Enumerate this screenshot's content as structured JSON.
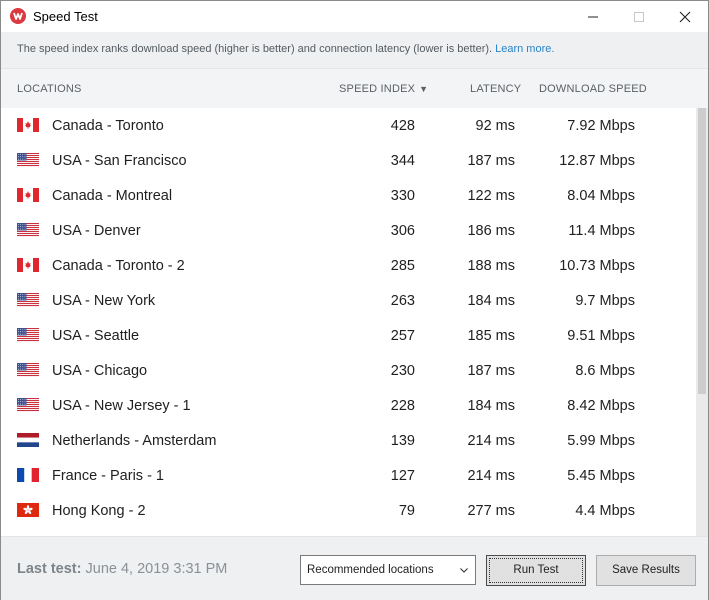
{
  "window": {
    "title": "Speed Test",
    "controls": [
      "minimize-icon",
      "maximize-icon",
      "close-icon"
    ]
  },
  "info": {
    "text": "The speed index ranks download speed (higher is better) and connection latency (lower is better).",
    "link": "Learn more."
  },
  "table": {
    "headers": {
      "location": "LOCATIONS",
      "speed_index": "SPEED INDEX",
      "sort_indicator": "▼",
      "latency": "LATENCY",
      "download": "DOWNLOAD SPEED"
    },
    "rows": [
      {
        "flag": "ca",
        "name": "Canada - Toronto",
        "speed_index": "428",
        "latency": "92 ms",
        "download": "7.92 Mbps"
      },
      {
        "flag": "us",
        "name": "USA - San Francisco",
        "speed_index": "344",
        "latency": "187 ms",
        "download": "12.87 Mbps"
      },
      {
        "flag": "ca",
        "name": "Canada - Montreal",
        "speed_index": "330",
        "latency": "122 ms",
        "download": "8.04 Mbps"
      },
      {
        "flag": "us",
        "name": "USA - Denver",
        "speed_index": "306",
        "latency": "186 ms",
        "download": "11.4 Mbps"
      },
      {
        "flag": "ca",
        "name": "Canada - Toronto - 2",
        "speed_index": "285",
        "latency": "188 ms",
        "download": "10.73 Mbps"
      },
      {
        "flag": "us",
        "name": "USA - New York",
        "speed_index": "263",
        "latency": "184 ms",
        "download": "9.7 Mbps"
      },
      {
        "flag": "us",
        "name": "USA - Seattle",
        "speed_index": "257",
        "latency": "185 ms",
        "download": "9.51 Mbps"
      },
      {
        "flag": "us",
        "name": "USA - Chicago",
        "speed_index": "230",
        "latency": "187 ms",
        "download": "8.6 Mbps"
      },
      {
        "flag": "us",
        "name": "USA - New Jersey - 1",
        "speed_index": "228",
        "latency": "184 ms",
        "download": "8.42 Mbps"
      },
      {
        "flag": "nl",
        "name": "Netherlands - Amsterdam",
        "speed_index": "139",
        "latency": "214 ms",
        "download": "5.99 Mbps"
      },
      {
        "flag": "fr",
        "name": "France - Paris - 1",
        "speed_index": "127",
        "latency": "214 ms",
        "download": "5.45 Mbps"
      },
      {
        "flag": "hk",
        "name": "Hong Kong - 2",
        "speed_index": "79",
        "latency": "277 ms",
        "download": "4.4 Mbps"
      }
    ]
  },
  "footer": {
    "last_test_label": "Last test:",
    "last_test_value": "June 4, 2019 3:31 PM",
    "location_select": "Recommended locations",
    "run_button": "Run Test",
    "save_button": "Save Results"
  },
  "colors": {
    "accent_link": "#2a84c7",
    "app_icon": "#da3940",
    "info_bg": "#eef0f2"
  }
}
